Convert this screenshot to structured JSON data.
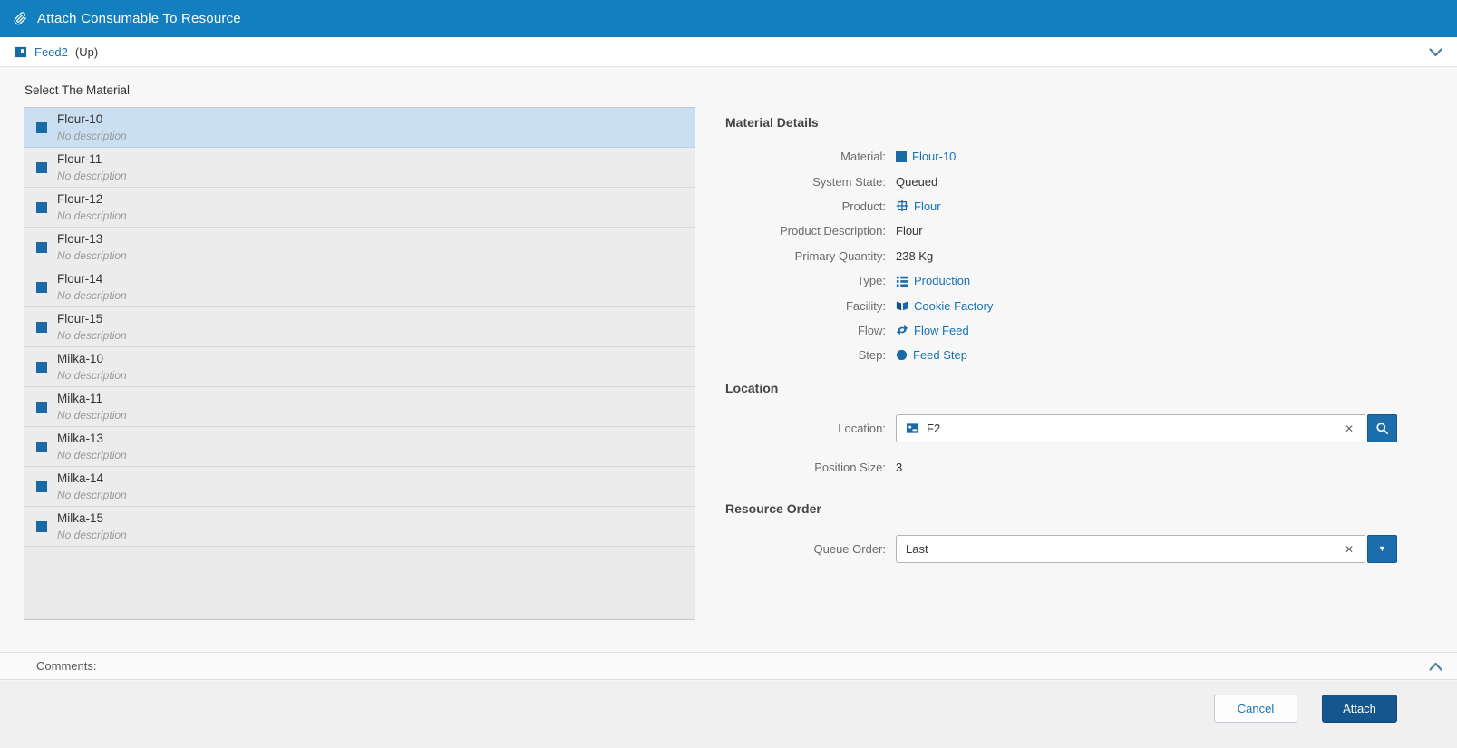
{
  "header": {
    "title": "Attach Consumable To Resource"
  },
  "resource_bar": {
    "name": "Feed2",
    "state": "(Up)"
  },
  "material_list": {
    "label": "Select The Material",
    "items": [
      {
        "name": "Flour-10",
        "description": "No description",
        "selected": true
      },
      {
        "name": "Flour-11",
        "description": "No description",
        "selected": false
      },
      {
        "name": "Flour-12",
        "description": "No description",
        "selected": false
      },
      {
        "name": "Flour-13",
        "description": "No description",
        "selected": false
      },
      {
        "name": "Flour-14",
        "description": "No description",
        "selected": false
      },
      {
        "name": "Flour-15",
        "description": "No description",
        "selected": false
      },
      {
        "name": "Milka-10",
        "description": "No description",
        "selected": false
      },
      {
        "name": "Milka-11",
        "description": "No description",
        "selected": false
      },
      {
        "name": "Milka-13",
        "description": "No description",
        "selected": false
      },
      {
        "name": "Milka-14",
        "description": "No description",
        "selected": false
      },
      {
        "name": "Milka-15",
        "description": "No description",
        "selected": false
      }
    ]
  },
  "material_details": {
    "title": "Material Details",
    "fields": [
      {
        "label": "Material:",
        "value": "Flour-10",
        "type": "link",
        "icon": "material-icon"
      },
      {
        "label": "System State:",
        "value": "Queued",
        "type": "text"
      },
      {
        "label": "Product:",
        "value": "Flour",
        "type": "link",
        "icon": "product-icon"
      },
      {
        "label": "Product Description:",
        "value": "Flour",
        "type": "text"
      },
      {
        "label": "Primary Quantity:",
        "value": "238 Kg",
        "type": "text"
      },
      {
        "label": "Type:",
        "value": "Production",
        "type": "link",
        "icon": "type-icon"
      },
      {
        "label": "Facility:",
        "value": "Cookie Factory",
        "type": "link",
        "icon": "facility-icon"
      },
      {
        "label": "Flow:",
        "value": "Flow Feed",
        "type": "link",
        "icon": "flow-icon"
      },
      {
        "label": "Step:",
        "value": "Feed Step",
        "type": "link",
        "icon": "step-icon"
      }
    ]
  },
  "location": {
    "title": "Location",
    "location_label": "Location:",
    "location_value": "F2",
    "position_size_label": "Position Size:",
    "position_size_value": "3"
  },
  "resource_order": {
    "title": "Resource Order",
    "queue_order_label": "Queue Order:",
    "queue_order_value": "Last"
  },
  "comments": {
    "label": "Comments:"
  },
  "footer": {
    "cancel_label": "Cancel",
    "attach_label": "Attach"
  },
  "icons": {
    "clear_glyph": "✕",
    "dropdown_arrow_glyph": "▼"
  },
  "colors": {
    "header_bg": "#147fbe",
    "link": "#1673b3",
    "selected_row": "#cbdff2",
    "attach_bg": "#15568f"
  }
}
